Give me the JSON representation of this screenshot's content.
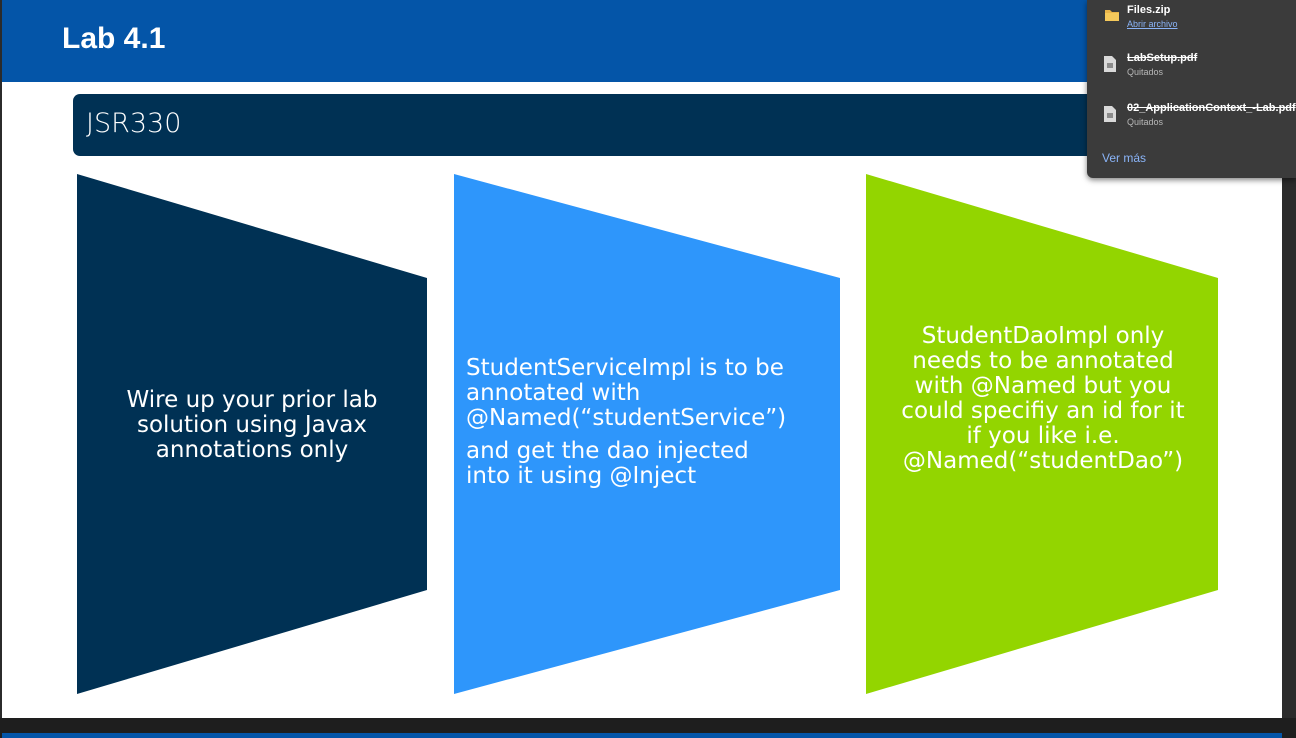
{
  "slide": {
    "title": "Lab 4.1",
    "subtitle": "JSR330",
    "colors": {
      "header": "#0455a8",
      "subtitle_bar": "#003154",
      "panel1": "#003154",
      "panel2": "#2e96fb",
      "panel3": "#93d500"
    },
    "panels": [
      {
        "lines": [
          "Wire up your prior lab",
          "solution using Javax",
          "annotations only"
        ]
      },
      {
        "paragraphs": [
          [
            "StudentServiceImpl is to be",
            "annotated with",
            "@Named(“studentService”)"
          ],
          [
            "and get the dao injected",
            "into it using @Inject"
          ]
        ]
      },
      {
        "lines": [
          "StudentDaoImpl only",
          "needs to be annotated",
          "with @Named but you",
          "could specifiy an id for it",
          "if you like i.e.",
          "@Named(“studentDao”)"
        ]
      }
    ]
  },
  "downloads": {
    "items": [
      {
        "name": "Files.zip",
        "status": "Abrir archivo",
        "icon": "folder-icon",
        "removed": false
      },
      {
        "name": "LabSetup.pdf",
        "status": "Quitados",
        "icon": "pdf-file-icon",
        "removed": true
      },
      {
        "name": "02_ApplicationContext_-Lab.pdf",
        "status": "Quitados",
        "icon": "pdf-file-icon",
        "removed": true
      }
    ],
    "see_more": "Ver más"
  }
}
